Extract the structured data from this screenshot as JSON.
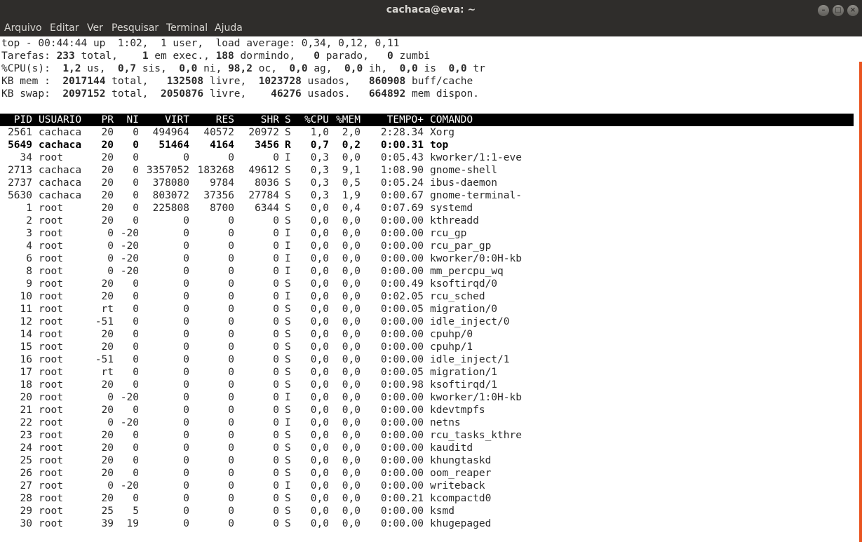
{
  "window": {
    "title": "cachaca@eva: ~"
  },
  "menu": [
    "Arquivo",
    "Editar",
    "Ver",
    "Pesquisar",
    "Terminal",
    "Ajuda"
  ],
  "summary": {
    "l1": "top - 00:44:44 up  1:02,  1 user,  load average: 0,34, 0,12, 0,11",
    "tasks": {
      "label": "Tarefas:",
      "total": "233",
      "running": "1",
      "sleeping": "188",
      "stopped": "0",
      "zombie": "0"
    },
    "cpu": {
      "label": "%CPU(s):",
      "us": "1,2",
      "sy": "0,7",
      "ni": "0,0",
      "id": "98,2",
      "wa": "0,0",
      "hi": "0,0",
      "si": "0,0",
      "st": "0,0"
    },
    "mem": {
      "label": "KB mem :",
      "total": "2017144",
      "free": "132508",
      "used": "1023728",
      "buff": "860908"
    },
    "swap": {
      "label": "KB swap:",
      "total": "2097152",
      "free": "2050876",
      "used": "46276",
      "avail": "664892"
    }
  },
  "columns": [
    "PID",
    "USUARIO",
    "PR",
    "NI",
    "VIRT",
    "RES",
    "SHR",
    "S",
    "%CPU",
    "%MEM",
    "TEMPO+",
    "COMANDO"
  ],
  "processes": [
    [
      "2561",
      "cachaca",
      "20",
      "0",
      "494964",
      "40572",
      "20972",
      "S",
      "1,0",
      "2,0",
      "2:28.34",
      "Xorg"
    ],
    [
      "5649",
      "cachaca",
      "20",
      "0",
      "51464",
      "4164",
      "3456",
      "R",
      "0,7",
      "0,2",
      "0:00.31",
      "top"
    ],
    [
      "34",
      "root",
      "20",
      "0",
      "0",
      "0",
      "0",
      "I",
      "0,3",
      "0,0",
      "0:05.43",
      "kworker/1:1-eve"
    ],
    [
      "2713",
      "cachaca",
      "20",
      "0",
      "3357052",
      "183268",
      "49612",
      "S",
      "0,3",
      "9,1",
      "1:08.90",
      "gnome-shell"
    ],
    [
      "2737",
      "cachaca",
      "20",
      "0",
      "378080",
      "9784",
      "8036",
      "S",
      "0,3",
      "0,5",
      "0:05.24",
      "ibus-daemon"
    ],
    [
      "5630",
      "cachaca",
      "20",
      "0",
      "803072",
      "37356",
      "27784",
      "S",
      "0,3",
      "1,9",
      "0:00.67",
      "gnome-terminal-"
    ],
    [
      "1",
      "root",
      "20",
      "0",
      "225808",
      "8700",
      "6344",
      "S",
      "0,0",
      "0,4",
      "0:07.69",
      "systemd"
    ],
    [
      "2",
      "root",
      "20",
      "0",
      "0",
      "0",
      "0",
      "S",
      "0,0",
      "0,0",
      "0:00.00",
      "kthreadd"
    ],
    [
      "3",
      "root",
      "0",
      "-20",
      "0",
      "0",
      "0",
      "I",
      "0,0",
      "0,0",
      "0:00.00",
      "rcu_gp"
    ],
    [
      "4",
      "root",
      "0",
      "-20",
      "0",
      "0",
      "0",
      "I",
      "0,0",
      "0,0",
      "0:00.00",
      "rcu_par_gp"
    ],
    [
      "6",
      "root",
      "0",
      "-20",
      "0",
      "0",
      "0",
      "I",
      "0,0",
      "0,0",
      "0:00.00",
      "kworker/0:0H-kb"
    ],
    [
      "8",
      "root",
      "0",
      "-20",
      "0",
      "0",
      "0",
      "I",
      "0,0",
      "0,0",
      "0:00.00",
      "mm_percpu_wq"
    ],
    [
      "9",
      "root",
      "20",
      "0",
      "0",
      "0",
      "0",
      "S",
      "0,0",
      "0,0",
      "0:00.49",
      "ksoftirqd/0"
    ],
    [
      "10",
      "root",
      "20",
      "0",
      "0",
      "0",
      "0",
      "I",
      "0,0",
      "0,0",
      "0:02.05",
      "rcu_sched"
    ],
    [
      "11",
      "root",
      "rt",
      "0",
      "0",
      "0",
      "0",
      "S",
      "0,0",
      "0,0",
      "0:00.05",
      "migration/0"
    ],
    [
      "12",
      "root",
      "-51",
      "0",
      "0",
      "0",
      "0",
      "S",
      "0,0",
      "0,0",
      "0:00.00",
      "idle_inject/0"
    ],
    [
      "14",
      "root",
      "20",
      "0",
      "0",
      "0",
      "0",
      "S",
      "0,0",
      "0,0",
      "0:00.00",
      "cpuhp/0"
    ],
    [
      "15",
      "root",
      "20",
      "0",
      "0",
      "0",
      "0",
      "S",
      "0,0",
      "0,0",
      "0:00.00",
      "cpuhp/1"
    ],
    [
      "16",
      "root",
      "-51",
      "0",
      "0",
      "0",
      "0",
      "S",
      "0,0",
      "0,0",
      "0:00.00",
      "idle_inject/1"
    ],
    [
      "17",
      "root",
      "rt",
      "0",
      "0",
      "0",
      "0",
      "S",
      "0,0",
      "0,0",
      "0:00.05",
      "migration/1"
    ],
    [
      "18",
      "root",
      "20",
      "0",
      "0",
      "0",
      "0",
      "S",
      "0,0",
      "0,0",
      "0:00.98",
      "ksoftirqd/1"
    ],
    [
      "20",
      "root",
      "0",
      "-20",
      "0",
      "0",
      "0",
      "I",
      "0,0",
      "0,0",
      "0:00.00",
      "kworker/1:0H-kb"
    ],
    [
      "21",
      "root",
      "20",
      "0",
      "0",
      "0",
      "0",
      "S",
      "0,0",
      "0,0",
      "0:00.00",
      "kdevtmpfs"
    ],
    [
      "22",
      "root",
      "0",
      "-20",
      "0",
      "0",
      "0",
      "I",
      "0,0",
      "0,0",
      "0:00.00",
      "netns"
    ],
    [
      "23",
      "root",
      "20",
      "0",
      "0",
      "0",
      "0",
      "S",
      "0,0",
      "0,0",
      "0:00.00",
      "rcu_tasks_kthre"
    ],
    [
      "24",
      "root",
      "20",
      "0",
      "0",
      "0",
      "0",
      "S",
      "0,0",
      "0,0",
      "0:00.00",
      "kauditd"
    ],
    [
      "25",
      "root",
      "20",
      "0",
      "0",
      "0",
      "0",
      "S",
      "0,0",
      "0,0",
      "0:00.00",
      "khungtaskd"
    ],
    [
      "26",
      "root",
      "20",
      "0",
      "0",
      "0",
      "0",
      "S",
      "0,0",
      "0,0",
      "0:00.00",
      "oom_reaper"
    ],
    [
      "27",
      "root",
      "0",
      "-20",
      "0",
      "0",
      "0",
      "I",
      "0,0",
      "0,0",
      "0:00.00",
      "writeback"
    ],
    [
      "28",
      "root",
      "20",
      "0",
      "0",
      "0",
      "0",
      "S",
      "0,0",
      "0,0",
      "0:00.21",
      "kcompactd0"
    ],
    [
      "29",
      "root",
      "25",
      "5",
      "0",
      "0",
      "0",
      "S",
      "0,0",
      "0,0",
      "0:00.00",
      "ksmd"
    ],
    [
      "30",
      "root",
      "39",
      "19",
      "0",
      "0",
      "0",
      "S",
      "0,0",
      "0,0",
      "0:00.00",
      "khugepaged"
    ]
  ],
  "highlight_pid": "5649",
  "colors": {
    "titlebar": "#2f2d2b",
    "scrollbar": "#e95420",
    "header_bg": "#000000"
  }
}
